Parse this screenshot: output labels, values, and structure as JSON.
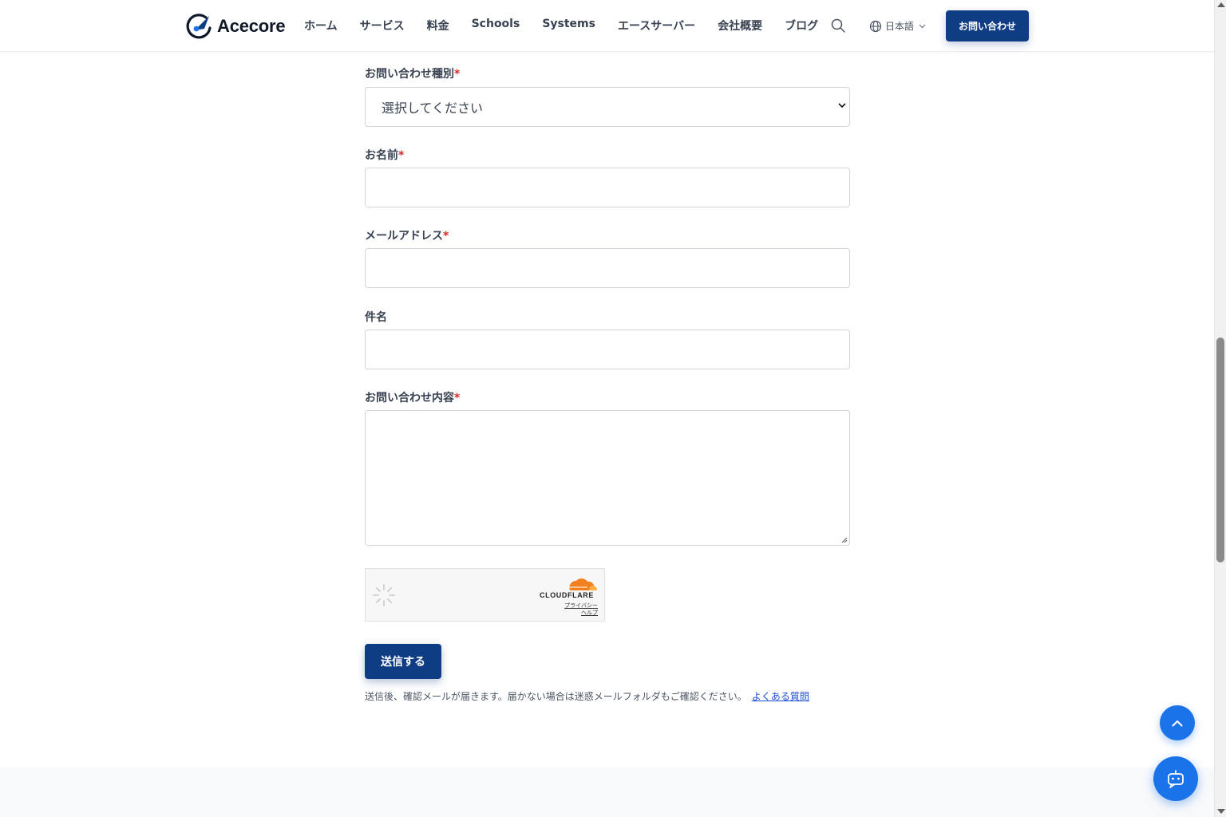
{
  "header": {
    "brand": "Acecore",
    "nav": [
      "ホーム",
      "サービス",
      "料金",
      "Schools",
      "Systems",
      "エースサーバー",
      "会社概要",
      "ブログ"
    ],
    "language": "日本語",
    "contact_label": "お問い合わせ"
  },
  "form": {
    "inquiry_type_label": "お問い合わせ種別",
    "inquiry_type_selected": "選択してください",
    "name_label": "お名前",
    "email_label": "メールアドレス",
    "subject_label": "件名",
    "message_label": "お問い合わせ内容",
    "required_mark": "*",
    "submit_label": "送信する",
    "note": "送信後、確認メールが届きます。届かない場合は迷惑メールフォルダもご確認ください。",
    "faq_link": "よくある質問"
  },
  "captcha": {
    "provider": "CLOUDFLARE",
    "privacy": "プライバシー",
    "help": "ヘルプ"
  },
  "colors": {
    "primary": "#0f3d84",
    "accent": "#1a73e8",
    "required": "#dc2626",
    "cloudflare_orange": "#f38020"
  },
  "icons": [
    "logo-icon",
    "search-icon",
    "globe-icon",
    "chevron-down-icon",
    "spinner-icon",
    "cloudflare-cloud-icon",
    "chevron-up-icon",
    "chatbot-icon"
  ]
}
